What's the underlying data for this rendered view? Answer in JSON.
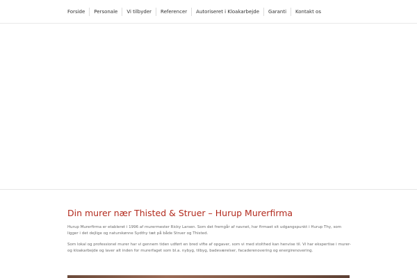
{
  "nav": {
    "items": [
      {
        "label": "Forside"
      },
      {
        "label": "Personale"
      },
      {
        "label": "Vi tilbyder"
      },
      {
        "label": "Referencer"
      },
      {
        "label": "Autoriseret i Kloakarbejde"
      },
      {
        "label": "Garanti"
      },
      {
        "label": "Kontakt os"
      }
    ]
  },
  "main": {
    "title": "Din murer nær Thisted & Struer – Hurup Murerfirma",
    "paragraph1": "Hurup Murerfirma er etableret i 1996 af murermester Ricky Larsen. Som det fremgår af navnet, har firmaet sit udgangspunkt i Hurup Thy, som ligger i det dejlige og naturskønne Sydthy tæt på både Struer og Thisted.",
    "paragraph2": "Som lokal og professionel murer har vi gennem tiden udført en bred vifte af opgaver, som vi med stolthed kan henvise til. Vi har ekspertise i murer- og kloakarbejde og laver alt inden for murerfaget som bl.a. nybyg, tilbyg, badeværelser, facaderenovering og energirenovering."
  },
  "colors": {
    "accent": "#b22a1d"
  }
}
